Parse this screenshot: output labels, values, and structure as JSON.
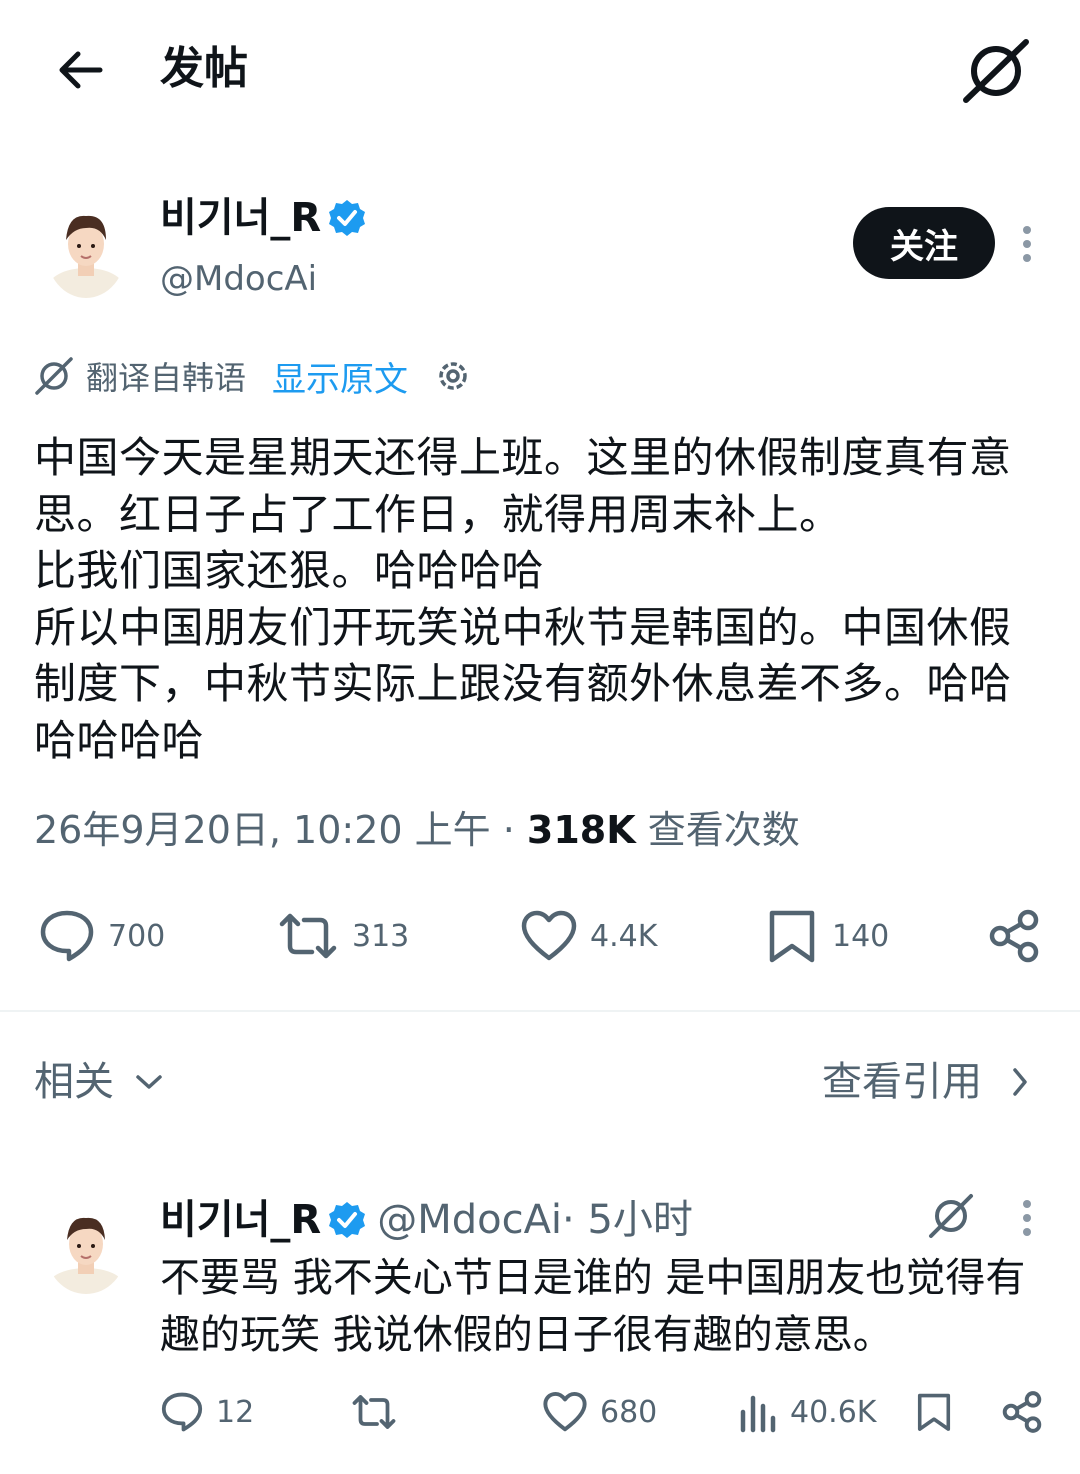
{
  "header": {
    "title": "发帖",
    "back_icon": "arrow-left-icon",
    "grok_icon": "grok-icon"
  },
  "post": {
    "author_name": "비기너_R",
    "author_handle": "@MdocAi",
    "verified": true,
    "follow_label": "关注",
    "translation": {
      "label": "翻译自韩语",
      "show_original": "显示原文"
    },
    "text": "中国今天是星期天还得上班。这里的休假制度真有意思。红日子占了工作日，就得用周末补上。\n比我们国家还狠。哈哈哈哈\n所以中国朋友们开玩笑说中秋节是韩国的。中国休假制度下，中秋节实际上跟没有额外休息差不多。哈哈哈哈哈哈",
    "timestamp": "26年9月20日, 10:20 上午",
    "separator": " · ",
    "views_count": "318K",
    "views_label": " 查看次数",
    "stats": {
      "replies": "700",
      "retweets": "313",
      "likes": "4.4K",
      "bookmarks": "140"
    }
  },
  "related": {
    "label": "相关",
    "quotes_label": "查看引用"
  },
  "reply": {
    "author_name": "비기너_R",
    "author_handle": "@MdocAi",
    "time": " · 5小时",
    "text": "不要骂 我不关心节日是谁的 是中国朋友也觉得有趣的玩笑 我说休假的日子很有趣的意思。",
    "stats": {
      "replies": "12",
      "retweets": "",
      "likes": "680",
      "views": "40.6K"
    }
  },
  "colors": {
    "text": "#0f1419",
    "secondary": "#536471",
    "accent": "#1d9bf0",
    "divider": "#eff3f4"
  }
}
